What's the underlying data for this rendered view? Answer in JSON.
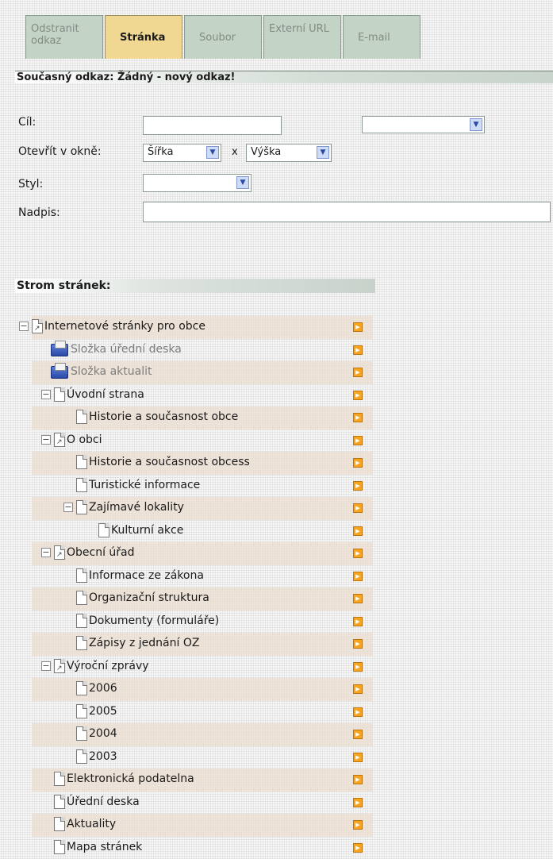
{
  "tabs": [
    {
      "label": "Odstranit odkaz",
      "active": false
    },
    {
      "label": "Stránka",
      "active": true
    },
    {
      "label": "Soubor",
      "active": false
    },
    {
      "label": "Externí URL",
      "active": false
    },
    {
      "label": "E-mail",
      "active": false
    }
  ],
  "current_link": "Současný odkaz: Žádný - nový odkaz!",
  "form": {
    "target_label": "Cíl:",
    "target_value": "",
    "target_select_value": "",
    "open_window_label": "Otevřít v okně:",
    "width_value": "Šířka",
    "times": "x",
    "height_value": "Výška",
    "style_label": "Styl:",
    "style_value": "",
    "title_label": "Nadpis:",
    "title_value": ""
  },
  "tree_title": "Strom stránek:",
  "tree": [
    {
      "label": "Internetové stránky pro obce",
      "depth": 0,
      "icon": "doc-link",
      "toggle": "minus",
      "band": true,
      "faded": false
    },
    {
      "label": "Složka úřední deska",
      "depth": 1,
      "icon": "folder",
      "toggle": null,
      "band": false,
      "faded": true
    },
    {
      "label": "Složka aktualit",
      "depth": 1,
      "icon": "folder",
      "toggle": null,
      "band": true,
      "faded": true
    },
    {
      "label": "Úvodní strana",
      "depth": 1,
      "icon": "doc",
      "toggle": "minus",
      "band": false,
      "faded": false
    },
    {
      "label": "Historie a současnost obce",
      "depth": 2,
      "icon": "doc",
      "toggle": null,
      "band": true,
      "faded": false
    },
    {
      "label": "O obci",
      "depth": 1,
      "icon": "doc-link",
      "toggle": "minus",
      "band": false,
      "faded": false
    },
    {
      "label": "Historie a současnost obcess",
      "depth": 2,
      "icon": "doc",
      "toggle": null,
      "band": true,
      "faded": false
    },
    {
      "label": "Turistické informace",
      "depth": 2,
      "icon": "doc",
      "toggle": null,
      "band": false,
      "faded": false
    },
    {
      "label": "Zajímavé lokality",
      "depth": 2,
      "icon": "doc",
      "toggle": "minus",
      "band": true,
      "faded": false
    },
    {
      "label": "Kulturní akce",
      "depth": 3,
      "icon": "doc",
      "toggle": null,
      "band": false,
      "faded": false
    },
    {
      "label": "Obecní úřad",
      "depth": 1,
      "icon": "doc-link",
      "toggle": "minus",
      "band": true,
      "faded": false
    },
    {
      "label": "Informace ze zákona",
      "depth": 2,
      "icon": "doc",
      "toggle": null,
      "band": false,
      "faded": false
    },
    {
      "label": "Organizační struktura",
      "depth": 2,
      "icon": "doc",
      "toggle": null,
      "band": true,
      "faded": false
    },
    {
      "label": "Dokumenty (formuláře)",
      "depth": 2,
      "icon": "doc",
      "toggle": null,
      "band": false,
      "faded": false
    },
    {
      "label": "Zápisy z jednání OZ",
      "depth": 2,
      "icon": "doc",
      "toggle": null,
      "band": true,
      "faded": false
    },
    {
      "label": "Výroční zprávy",
      "depth": 1,
      "icon": "doc-link",
      "toggle": "minus",
      "band": false,
      "faded": false
    },
    {
      "label": "2006",
      "depth": 2,
      "icon": "doc",
      "toggle": null,
      "band": true,
      "faded": false
    },
    {
      "label": "2005",
      "depth": 2,
      "icon": "doc",
      "toggle": null,
      "band": false,
      "faded": false
    },
    {
      "label": "2004",
      "depth": 2,
      "icon": "doc",
      "toggle": null,
      "band": true,
      "faded": false
    },
    {
      "label": "2003",
      "depth": 2,
      "icon": "doc",
      "toggle": null,
      "band": false,
      "faded": false
    },
    {
      "label": "Elektronická podatelna",
      "depth": 1,
      "icon": "doc",
      "toggle": null,
      "band": true,
      "faded": false
    },
    {
      "label": "Úřední deska",
      "depth": 1,
      "icon": "doc",
      "toggle": null,
      "band": false,
      "faded": false
    },
    {
      "label": "Aktuality",
      "depth": 1,
      "icon": "doc",
      "toggle": null,
      "band": true,
      "faded": false
    },
    {
      "label": "Mapa stránek",
      "depth": 1,
      "icon": "doc",
      "toggle": null,
      "band": false,
      "faded": false
    }
  ]
}
